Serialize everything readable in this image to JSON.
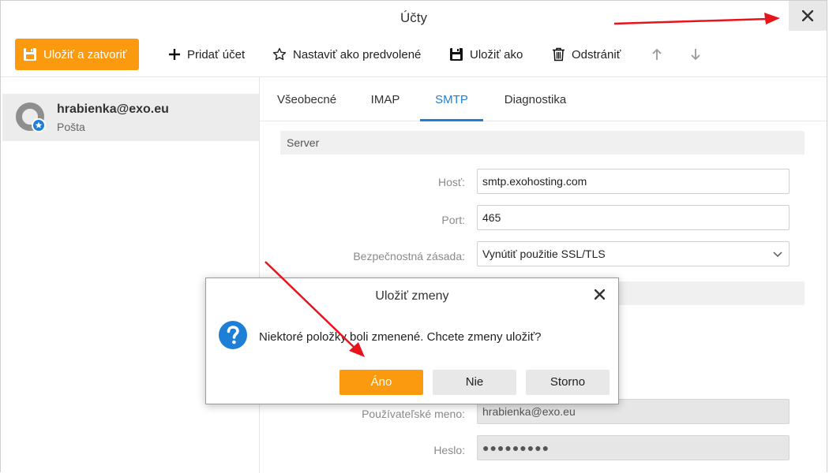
{
  "window": {
    "title": "Účty"
  },
  "toolbar": {
    "save_close": "Uložiť a zatvoriť",
    "add_account": "Pridať účet",
    "set_default": "Nastaviť ako predvolené",
    "save_as": "Uložiť ako",
    "delete": "Odstrániť"
  },
  "sidebar": {
    "account": {
      "name": "hrabienka@exo.eu",
      "type": "Pošta"
    }
  },
  "tabs": [
    {
      "label": "Všeobecné",
      "active": false
    },
    {
      "label": "IMAP",
      "active": false
    },
    {
      "label": "SMTP",
      "active": true
    },
    {
      "label": "Diagnostika",
      "active": false
    }
  ],
  "server": {
    "section_title": "Server",
    "host_label": "Hosť:",
    "host_value": "smtp.exohosting.com",
    "port_label": "Port:",
    "port_value": "465",
    "security_label": "Bezpečnostná zásada:",
    "security_value": "Vynútiť použitie SSL/TLS"
  },
  "auth": {
    "username_label": "Používateľské meno:",
    "username_value": "hrabienka@exo.eu",
    "password_label": "Heslo:",
    "password_value": "●●●●●●●●●"
  },
  "dialog": {
    "title": "Uložiť zmeny",
    "message": "Niektoré položky boli zmenené. Chcete zmeny uložiť?",
    "yes": "Áno",
    "no": "Nie",
    "cancel": "Storno"
  },
  "colors": {
    "accent": "#fb9a0e",
    "tab_active": "#1e7fd6",
    "question_icon": "#1e7fd6",
    "annotation_arrow": "#e8141b"
  }
}
